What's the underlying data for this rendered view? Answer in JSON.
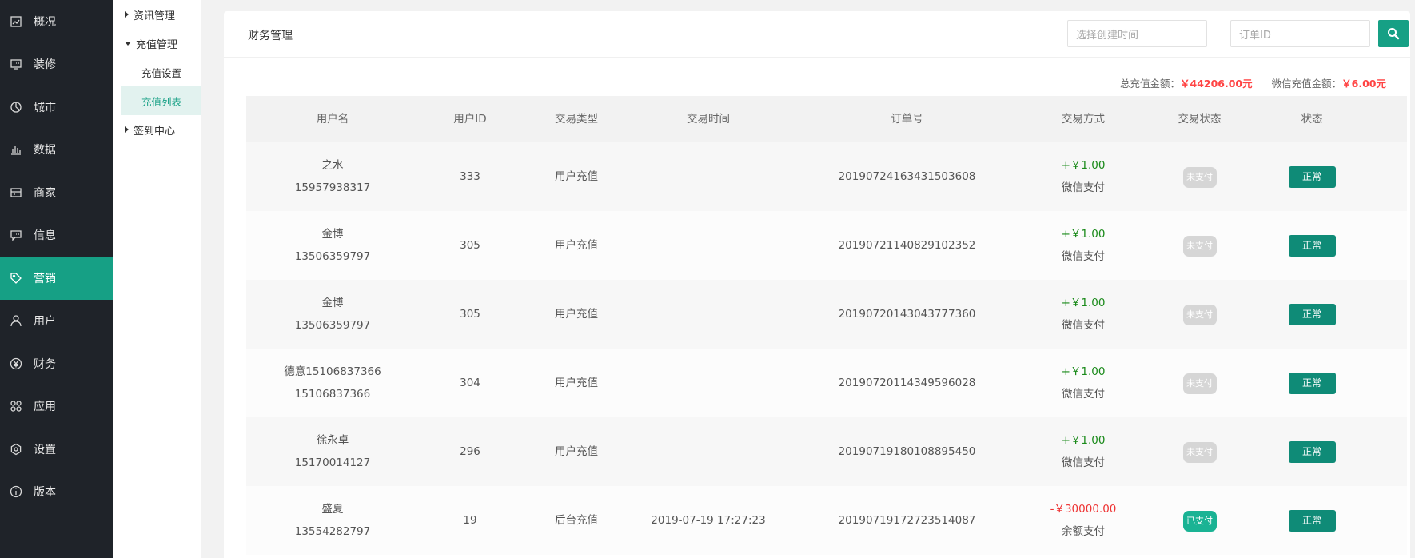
{
  "sidebar": {
    "items": [
      {
        "label": "概况",
        "icon": "overview-icon"
      },
      {
        "label": "装修",
        "icon": "decoration-icon"
      },
      {
        "label": "城市",
        "icon": "city-icon"
      },
      {
        "label": "数据",
        "icon": "data-icon"
      },
      {
        "label": "商家",
        "icon": "merchant-icon"
      },
      {
        "label": "信息",
        "icon": "message-icon"
      },
      {
        "label": "营销",
        "icon": "tag-icon",
        "active": true
      },
      {
        "label": "用户",
        "icon": "user-icon"
      },
      {
        "label": "财务",
        "icon": "yuan-icon"
      },
      {
        "label": "应用",
        "icon": "apps-icon"
      },
      {
        "label": "设置",
        "icon": "gear-icon"
      },
      {
        "label": "版本",
        "icon": "info-icon"
      }
    ]
  },
  "submenu": {
    "group_news": "资讯管理",
    "group_recharge": "充值管理",
    "item_settings": "充值设置",
    "item_list": "充值列表",
    "group_checkin": "签到中心"
  },
  "header": {
    "title": "财务管理",
    "time_placeholder": "选择创建时间",
    "order_placeholder": "订单ID"
  },
  "summary": {
    "total_label": "总充值金额：",
    "total_value": "￥44206.00元",
    "wechat_label": "微信充值金额：",
    "wechat_value": "￥6.00元"
  },
  "colors": {
    "accent": "#16a085",
    "dark": "#1f2329",
    "danger": "#ee3333",
    "success": "#1a8a1a"
  },
  "table": {
    "headers": [
      "用户名",
      "用户ID",
      "交易类型",
      "交易时间",
      "订单号",
      "交易方式",
      "交易状态",
      "状态"
    ],
    "rows": [
      {
        "name": "之水",
        "phone": "15957938317",
        "uid": "333",
        "type": "用户充值",
        "time": "",
        "order": "20190724163431503608",
        "amount": "+￥1.00",
        "sign": "plus",
        "method": "微信支付",
        "pay_status": "未支付",
        "paid": false,
        "status": "正常"
      },
      {
        "name": "金博",
        "phone": "13506359797",
        "uid": "305",
        "type": "用户充值",
        "time": "",
        "order": "20190721140829102352",
        "amount": "+￥1.00",
        "sign": "plus",
        "method": "微信支付",
        "pay_status": "未支付",
        "paid": false,
        "status": "正常"
      },
      {
        "name": "金博",
        "phone": "13506359797",
        "uid": "305",
        "type": "用户充值",
        "time": "",
        "order": "20190720143043777360",
        "amount": "+￥1.00",
        "sign": "plus",
        "method": "微信支付",
        "pay_status": "未支付",
        "paid": false,
        "status": "正常"
      },
      {
        "name": "德意15106837366",
        "phone": "15106837366",
        "uid": "304",
        "type": "用户充值",
        "time": "",
        "order": "20190720114349596028",
        "amount": "+￥1.00",
        "sign": "plus",
        "method": "微信支付",
        "pay_status": "未支付",
        "paid": false,
        "status": "正常"
      },
      {
        "name": "徐永卓",
        "phone": "15170014127",
        "uid": "296",
        "type": "用户充值",
        "time": "",
        "order": "20190719180108895450",
        "amount": "+￥1.00",
        "sign": "plus",
        "method": "微信支付",
        "pay_status": "未支付",
        "paid": false,
        "status": "正常"
      },
      {
        "name": "盛夏",
        "phone": "13554282797",
        "uid": "19",
        "type": "后台充值",
        "time": "2019-07-19 17:27:23",
        "order": "20190719172723514087",
        "amount": "-￥30000.00",
        "sign": "minus",
        "method": "余额支付",
        "pay_status": "已支付",
        "paid": true,
        "status": "正常"
      }
    ]
  }
}
